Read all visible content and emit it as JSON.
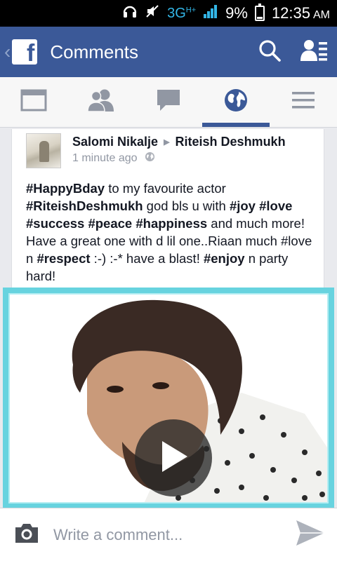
{
  "status_bar": {
    "network": "3G",
    "network_sup": "H+",
    "battery": "9%",
    "time": "12:35",
    "ampm": "AM"
  },
  "app_bar": {
    "title": "Comments",
    "icons": [
      "back-icon",
      "facebook-logo",
      "search-icon",
      "friend-requests-icon"
    ],
    "brand_color": "#3b5998"
  },
  "tabs": [
    {
      "icon": "news-feed-icon",
      "active": false
    },
    {
      "icon": "friends-icon",
      "active": false
    },
    {
      "icon": "messages-icon",
      "active": false
    },
    {
      "icon": "notifications-globe-icon",
      "active": true
    },
    {
      "icon": "more-menu-icon",
      "active": false
    }
  ],
  "post": {
    "author": "Salomi Nikalje",
    "target": "Riteish Deshmukh",
    "time": "1 minute ago",
    "privacy_icon": "public-globe-icon",
    "text": {
      "t1": "#HappyBday",
      "t2": " to my favourite actor ",
      "t3": "#RiteishDeshmukh",
      "t4": " god bls u with ",
      "t5": "#joy",
      "t6": " ",
      "t7": "#love",
      "t8": " ",
      "t9": "#success",
      "t10": " ",
      "t11": "#peace",
      "t12": " ",
      "t13": "#happiness",
      "t14": " and much more! Have a great one with d lil one..Riaan much #love n ",
      "t15": "#respect",
      "t16": " :-) :-* have a blast! ",
      "t17": "#enjoy",
      "t18": " n party hard!"
    },
    "video": {
      "play_icon": "play-icon",
      "border_color": "#67d3df"
    }
  },
  "comment_bar": {
    "placeholder": "Write a comment...",
    "camera_icon": "camera-icon",
    "send_icon": "send-icon"
  }
}
